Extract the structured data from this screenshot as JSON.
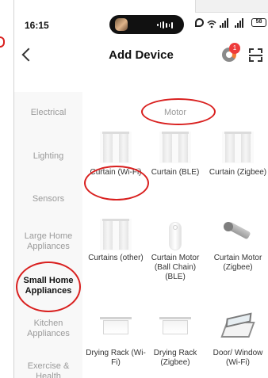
{
  "status_bar": {
    "time": "16:15",
    "battery": "58"
  },
  "header": {
    "title": "Add Device",
    "notification_count": "1"
  },
  "sidebar": {
    "items": [
      {
        "label": "Electrical",
        "active": false
      },
      {
        "label": "Lighting",
        "active": false
      },
      {
        "label": "Sensors",
        "active": false
      },
      {
        "label": "Large Home Appliances",
        "active": false
      },
      {
        "label": "Small Home Appliances",
        "active": true
      },
      {
        "label": "Kitchen Appliances",
        "active": false
      },
      {
        "label": "Exercise & Health",
        "active": false
      }
    ]
  },
  "content": {
    "section_title": "Motor",
    "devices": [
      {
        "label": "Curtain (Wi-Fi)",
        "icon": "curtain-icon"
      },
      {
        "label": "Curtain (BLE)",
        "icon": "curtain-icon"
      },
      {
        "label": "Curtain (Zigbee)",
        "icon": "curtain-icon"
      },
      {
        "label": "Curtains (other)",
        "icon": "curtain-icon"
      },
      {
        "label": "Curtain Motor (Ball Chain) (BLE)",
        "icon": "curtain-motor-icon"
      },
      {
        "label": "Curtain Motor (Zigbee)",
        "icon": "curtain-motor-icon"
      },
      {
        "label": "Drying Rack (Wi-Fi)",
        "icon": "drying-rack-icon"
      },
      {
        "label": "Drying Rack (Zigbee)",
        "icon": "drying-rack-icon"
      },
      {
        "label": "Door/ Window (Wi-Fi)",
        "icon": "window-opener-icon"
      }
    ]
  },
  "colors": {
    "annotation": "#d9201f",
    "badge": "#ee3b3b",
    "sidebar_bg": "#f8f8f8"
  }
}
